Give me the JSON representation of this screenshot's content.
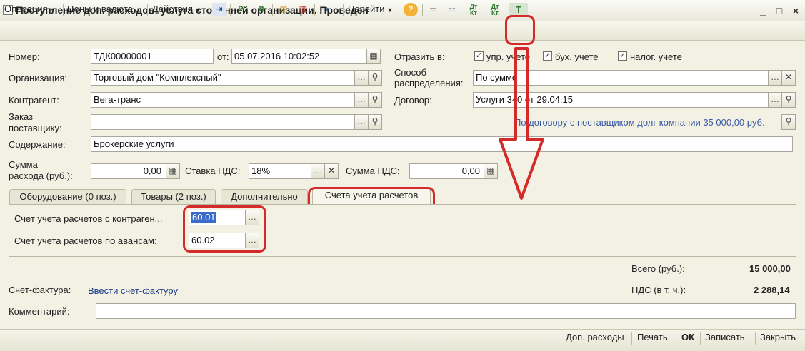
{
  "window": {
    "title": "Поступление доп. расходов: услуга сторонней организации. Проведен",
    "minimize": "_",
    "maximize": "□",
    "close": "×"
  },
  "toolbar": {
    "operation": "Операция",
    "prices": "Цены и валюта...",
    "actions": "Действия",
    "goto": "Перейти",
    "help_icon": "question-icon",
    "dt_kt_1": "Дт Кт",
    "dt_kt_2": "Дт Кт",
    "accounts_icon": "Т"
  },
  "form": {
    "number_label": "Номер:",
    "number_value": "ТДК00000001",
    "from_label": "от:",
    "date_value": "05.07.2016 10:02:52",
    "reflect_label": "Отразить в:",
    "reflect_mgmt": "упр. учете",
    "reflect_acc": "бух. учете",
    "reflect_tax": "налог. учете",
    "org_label": "Организация:",
    "org_value": "Торговый дом \"Комплексный\"",
    "distribution_label_1": "Способ",
    "distribution_label_2": "распределения:",
    "distribution_value": "По сумме",
    "counterparty_label": "Контрагент:",
    "counterparty_value": "Вега-транс",
    "contract_label": "Договор:",
    "contract_value": "Услуги 340 от 29.04.15",
    "order_label_1": "Заказ",
    "order_label_2": "поставщику:",
    "order_value": "",
    "debt_hint": "По договору с поставщиком долг компании 35 000,00 руб.",
    "content_label": "Содержание:",
    "content_value": "Брокерские услуги",
    "amount_label_1": "Сумма",
    "amount_label_2": "расхода (руб.):",
    "amount_value": "0,00",
    "vat_rate_label": "Ставка НДС:",
    "vat_rate_value": "18%",
    "vat_sum_label": "Сумма НДС:",
    "vat_sum_value": "0,00"
  },
  "tabs": [
    {
      "label": "Оборудование (0 поз.)"
    },
    {
      "label": "Товары (2 поз.)"
    },
    {
      "label": "Дополнительно"
    },
    {
      "label": "Счета учета расчетов"
    }
  ],
  "accounts": {
    "settle_label": "Счет учета расчетов с контраген...",
    "settle_value": "60.01",
    "advance_label": "Счет учета расчетов по авансам:",
    "advance_value": "60.02"
  },
  "totals": {
    "total_label": "Всего (руб.):",
    "total_value": "15 000,00",
    "vat_label": "НДС (в т. ч.):",
    "vat_value": "2 288,14"
  },
  "invoice": {
    "label": "Счет-фактура:",
    "link": "Ввести счет-фактуру"
  },
  "comment": {
    "label": "Комментарий:",
    "value": ""
  },
  "bottom": {
    "extra_costs": "Доп. расходы",
    "print": "Печать",
    "ok": "ОК",
    "save": "Записать",
    "close": "Закрыть"
  },
  "colors": {
    "annotation": "#d42a2a",
    "background": "#f2f1e4",
    "link": "#1c3c8a"
  }
}
